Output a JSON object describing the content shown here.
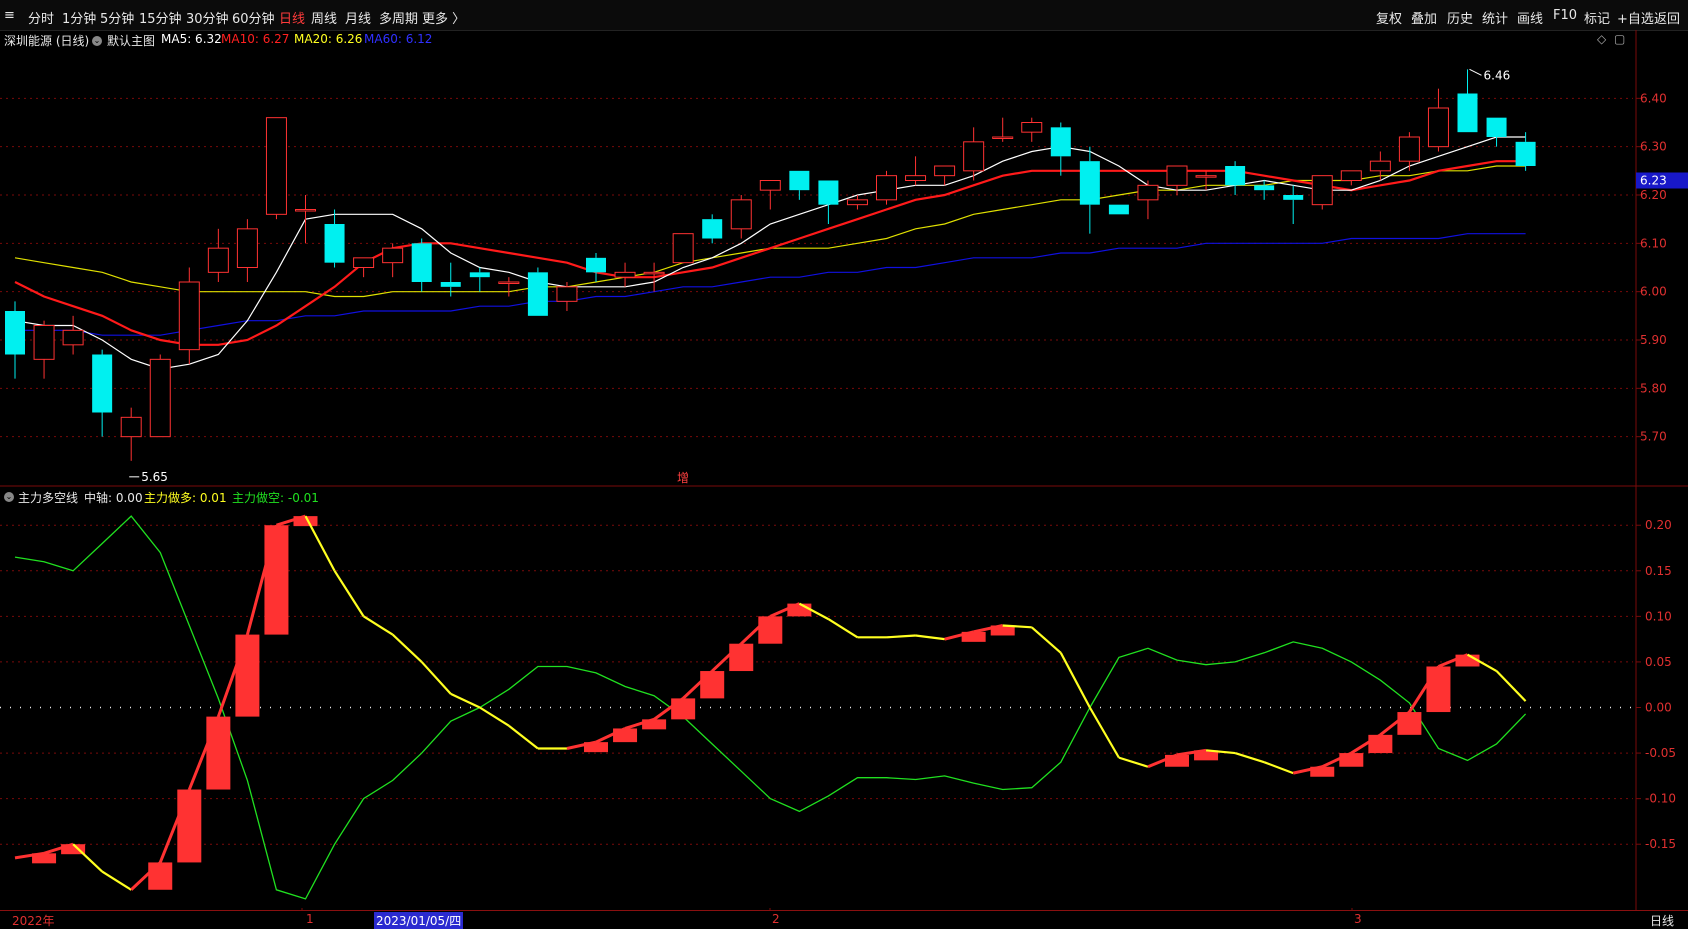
{
  "toolbar": {
    "left_icon": "≡",
    "periods": [
      "分时",
      "1分钟",
      "5分钟",
      "15分钟",
      "30分钟",
      "60分钟",
      "日线",
      "周线",
      "月线",
      "多周期",
      "更多 〉"
    ],
    "active_period": "日线",
    "right_items": [
      "复权",
      "叠加",
      "历史",
      "统计",
      "画线",
      "F10",
      "标记",
      "+自选",
      "返回"
    ]
  },
  "main_header": {
    "stock": "深圳能源 (日线)",
    "template": "默认主图",
    "ma5": "MA5: 6.32",
    "ma10": "MA10: 6.27",
    "ma20": "MA20: 6.26",
    "ma60": "MA60: 6.12"
  },
  "indicator_header": {
    "name": "主力多空线",
    "zhongzhou": "中轴: 0.00",
    "long": "主力做多: 0.01",
    "short": "主力做空: -0.01"
  },
  "price_labels": {
    "high": "6.46",
    "low": "5.65",
    "current": "6.23",
    "marker": "增"
  },
  "bottom_axis": {
    "year": "2022年",
    "m1": "1",
    "date": "2023/01/05/四",
    "m2": "2",
    "m3": "3",
    "period": "日线"
  },
  "colors": {
    "up": "#ff3232",
    "down": "#00f0f0",
    "ma5": "#ffffff",
    "ma10": "#ff1a1a",
    "ma20": "#e0e000",
    "ma60": "#1010e0",
    "long": "#ffff20",
    "short": "#20e020",
    "grid": "#7a0a0a",
    "axis_text": "#e03030"
  },
  "chart_data": [
    {
      "type": "candlestick",
      "title": "深圳能源 (日线)",
      "ylim": [
        5.6,
        6.5
      ],
      "yticks": [
        5.7,
        5.8,
        5.9,
        6.0,
        6.1,
        6.2,
        6.3,
        6.4
      ],
      "candles": [
        {
          "o": 5.96,
          "h": 5.98,
          "l": 5.82,
          "c": 5.87
        },
        {
          "o": 5.86,
          "h": 5.94,
          "l": 5.82,
          "c": 5.93
        },
        {
          "o": 5.89,
          "h": 5.95,
          "l": 5.87,
          "c": 5.92
        },
        {
          "o": 5.87,
          "h": 5.88,
          "l": 5.7,
          "c": 5.75
        },
        {
          "o": 5.7,
          "h": 5.76,
          "l": 5.65,
          "c": 5.74
        },
        {
          "o": 5.7,
          "h": 5.87,
          "l": 5.7,
          "c": 5.86
        },
        {
          "o": 5.88,
          "h": 6.05,
          "l": 5.85,
          "c": 6.02
        },
        {
          "o": 6.04,
          "h": 6.13,
          "l": 6.02,
          "c": 6.09
        },
        {
          "o": 6.05,
          "h": 6.15,
          "l": 6.02,
          "c": 6.13
        },
        {
          "o": 6.16,
          "h": 6.36,
          "l": 6.15,
          "c": 6.36
        },
        {
          "o": 6.17,
          "h": 6.2,
          "l": 6.1,
          "c": 6.17
        },
        {
          "o": 6.14,
          "h": 6.17,
          "l": 6.05,
          "c": 6.06
        },
        {
          "o": 6.05,
          "h": 6.07,
          "l": 6.03,
          "c": 6.07
        },
        {
          "o": 6.06,
          "h": 6.1,
          "l": 6.03,
          "c": 6.09
        },
        {
          "o": 6.1,
          "h": 6.11,
          "l": 6.0,
          "c": 6.02
        },
        {
          "o": 6.02,
          "h": 6.06,
          "l": 5.99,
          "c": 6.01
        },
        {
          "o": 6.04,
          "h": 6.05,
          "l": 6.0,
          "c": 6.03
        },
        {
          "o": 6.02,
          "h": 6.03,
          "l": 5.99,
          "c": 6.02
        },
        {
          "o": 6.04,
          "h": 6.05,
          "l": 5.95,
          "c": 5.95
        },
        {
          "o": 5.98,
          "h": 6.02,
          "l": 5.96,
          "c": 6.01
        },
        {
          "o": 6.07,
          "h": 6.08,
          "l": 6.02,
          "c": 6.04
        },
        {
          "o": 6.03,
          "h": 6.06,
          "l": 6.01,
          "c": 6.04
        },
        {
          "o": 6.04,
          "h": 6.06,
          "l": 6.0,
          "c": 6.04
        },
        {
          "o": 6.06,
          "h": 6.12,
          "l": 6.06,
          "c": 6.12
        },
        {
          "o": 6.15,
          "h": 6.16,
          "l": 6.1,
          "c": 6.11
        },
        {
          "o": 6.13,
          "h": 6.2,
          "l": 6.11,
          "c": 6.19
        },
        {
          "o": 6.21,
          "h": 6.23,
          "l": 6.17,
          "c": 6.23
        },
        {
          "o": 6.25,
          "h": 6.25,
          "l": 6.19,
          "c": 6.21
        },
        {
          "o": 6.23,
          "h": 6.23,
          "l": 6.14,
          "c": 6.18
        },
        {
          "o": 6.18,
          "h": 6.2,
          "l": 6.17,
          "c": 6.19
        },
        {
          "o": 6.19,
          "h": 6.25,
          "l": 6.18,
          "c": 6.24
        },
        {
          "o": 6.23,
          "h": 6.28,
          "l": 6.22,
          "c": 6.24
        },
        {
          "o": 6.24,
          "h": 6.26,
          "l": 6.22,
          "c": 6.26
        },
        {
          "o": 6.25,
          "h": 6.34,
          "l": 6.23,
          "c": 6.31
        },
        {
          "o": 6.32,
          "h": 6.36,
          "l": 6.31,
          "c": 6.32
        },
        {
          "o": 6.33,
          "h": 6.36,
          "l": 6.31,
          "c": 6.35
        },
        {
          "o": 6.34,
          "h": 6.35,
          "l": 6.24,
          "c": 6.28
        },
        {
          "o": 6.27,
          "h": 6.3,
          "l": 6.12,
          "c": 6.18
        },
        {
          "o": 6.18,
          "h": 6.18,
          "l": 6.16,
          "c": 6.16
        },
        {
          "o": 6.19,
          "h": 6.23,
          "l": 6.15,
          "c": 6.22
        },
        {
          "o": 6.22,
          "h": 6.26,
          "l": 6.2,
          "c": 6.26
        },
        {
          "o": 6.24,
          "h": 6.25,
          "l": 6.21,
          "c": 6.24
        },
        {
          "o": 6.26,
          "h": 6.27,
          "l": 6.2,
          "c": 6.22
        },
        {
          "o": 6.22,
          "h": 6.23,
          "l": 6.19,
          "c": 6.21
        },
        {
          "o": 6.2,
          "h": 6.22,
          "l": 6.14,
          "c": 6.19
        },
        {
          "o": 6.18,
          "h": 6.24,
          "l": 6.17,
          "c": 6.24
        },
        {
          "o": 6.23,
          "h": 6.25,
          "l": 6.22,
          "c": 6.25
        },
        {
          "o": 6.25,
          "h": 6.29,
          "l": 6.23,
          "c": 6.27
        },
        {
          "o": 6.27,
          "h": 6.33,
          "l": 6.25,
          "c": 6.32
        },
        {
          "o": 6.3,
          "h": 6.42,
          "l": 6.29,
          "c": 6.38
        },
        {
          "o": 6.41,
          "h": 6.46,
          "l": 6.33,
          "c": 6.33
        },
        {
          "o": 6.36,
          "h": 6.36,
          "l": 6.3,
          "c": 6.32
        },
        {
          "o": 6.31,
          "h": 6.33,
          "l": 6.25,
          "c": 6.26
        }
      ],
      "series": [
        {
          "name": "MA5",
          "values": [
            5.94,
            5.93,
            5.93,
            5.9,
            5.86,
            5.84,
            5.85,
            5.87,
            5.94,
            6.04,
            6.15,
            6.16,
            6.16,
            6.16,
            6.13,
            6.08,
            6.05,
            6.04,
            6.02,
            6.01,
            6.01,
            6.01,
            6.02,
            6.05,
            6.07,
            6.1,
            6.14,
            6.16,
            6.18,
            6.2,
            6.21,
            6.22,
            6.22,
            6.24,
            6.27,
            6.29,
            6.3,
            6.29,
            6.26,
            6.22,
            6.21,
            6.21,
            6.22,
            6.23,
            6.22,
            6.21,
            6.21,
            6.23,
            6.26,
            6.28,
            6.3,
            6.32,
            6.32
          ]
        },
        {
          "name": "MA10",
          "values": [
            6.02,
            5.99,
            5.97,
            5.95,
            5.92,
            5.9,
            5.89,
            5.89,
            5.9,
            5.93,
            5.97,
            6.01,
            6.06,
            6.09,
            6.1,
            6.1,
            6.09,
            6.08,
            6.07,
            6.06,
            6.04,
            6.03,
            6.03,
            6.04,
            6.05,
            6.07,
            6.09,
            6.11,
            6.13,
            6.15,
            6.17,
            6.19,
            6.2,
            6.22,
            6.24,
            6.25,
            6.25,
            6.25,
            6.25,
            6.25,
            6.25,
            6.25,
            6.25,
            6.24,
            6.23,
            6.22,
            6.21,
            6.22,
            6.23,
            6.25,
            6.26,
            6.27,
            6.27
          ]
        },
        {
          "name": "MA20",
          "values": [
            6.07,
            6.06,
            6.05,
            6.04,
            6.02,
            6.01,
            6.0,
            6.0,
            6.0,
            6.0,
            6.0,
            5.99,
            5.99,
            6.0,
            6.0,
            6.0,
            6.0,
            6.0,
            6.01,
            6.01,
            6.02,
            6.03,
            6.04,
            6.06,
            6.07,
            6.08,
            6.09,
            6.09,
            6.09,
            6.1,
            6.11,
            6.13,
            6.14,
            6.16,
            6.17,
            6.18,
            6.19,
            6.19,
            6.2,
            6.21,
            6.21,
            6.22,
            6.22,
            6.22,
            6.23,
            6.23,
            6.23,
            6.24,
            6.24,
            6.25,
            6.25,
            6.26,
            6.26
          ]
        },
        {
          "name": "MA60",
          "values": [
            5.92,
            5.92,
            5.92,
            5.91,
            5.91,
            5.91,
            5.92,
            5.93,
            5.94,
            5.94,
            5.95,
            5.95,
            5.96,
            5.96,
            5.96,
            5.96,
            5.97,
            5.97,
            5.98,
            5.98,
            5.99,
            5.99,
            6.0,
            6.01,
            6.01,
            6.02,
            6.03,
            6.03,
            6.04,
            6.04,
            6.05,
            6.05,
            6.06,
            6.07,
            6.07,
            6.07,
            6.08,
            6.08,
            6.09,
            6.09,
            6.09,
            6.1,
            6.1,
            6.1,
            6.1,
            6.1,
            6.11,
            6.11,
            6.11,
            6.11,
            6.12,
            6.12,
            6.12
          ]
        }
      ]
    },
    {
      "type": "line",
      "title": "主力多空线",
      "ylim": [
        -0.22,
        0.22
      ],
      "yticks": [
        -0.15,
        -0.1,
        -0.05,
        0.0,
        0.05,
        0.1,
        0.15,
        0.2
      ],
      "series": [
        {
          "name": "主力做多",
          "values": [
            -0.165,
            -0.16,
            -0.15,
            -0.18,
            -0.2,
            -0.17,
            -0.09,
            -0.01,
            0.08,
            0.2,
            0.21,
            0.15,
            0.1,
            0.08,
            0.05,
            0.015,
            0.0,
            -0.02,
            -0.045,
            -0.045,
            -0.038,
            -0.023,
            -0.013,
            0.01,
            0.04,
            0.07,
            0.1,
            0.114,
            0.097,
            0.077,
            0.077,
            0.079,
            0.075,
            0.083,
            0.09,
            0.088,
            0.06,
            0.0,
            -0.055,
            -0.065,
            -0.052,
            -0.047,
            -0.05,
            -0.06,
            -0.072,
            -0.065,
            -0.05,
            -0.03,
            -0.005,
            0.045,
            0.058,
            0.04,
            0.007
          ]
        },
        {
          "name": "主力做空",
          "values": [
            0.165,
            0.16,
            0.15,
            0.18,
            0.21,
            0.17,
            0.09,
            0.01,
            -0.08,
            -0.2,
            -0.21,
            -0.15,
            -0.1,
            -0.08,
            -0.05,
            -0.015,
            0.0,
            0.02,
            0.045,
            0.045,
            0.038,
            0.023,
            0.013,
            -0.01,
            -0.04,
            -0.07,
            -0.1,
            -0.114,
            -0.097,
            -0.077,
            -0.077,
            -0.079,
            -0.075,
            -0.083,
            -0.09,
            -0.088,
            -0.06,
            0.0,
            0.055,
            0.065,
            0.052,
            0.047,
            0.05,
            0.06,
            0.072,
            0.065,
            0.05,
            0.03,
            0.005,
            -0.045,
            -0.058,
            -0.04,
            -0.007
          ]
        }
      ]
    }
  ]
}
